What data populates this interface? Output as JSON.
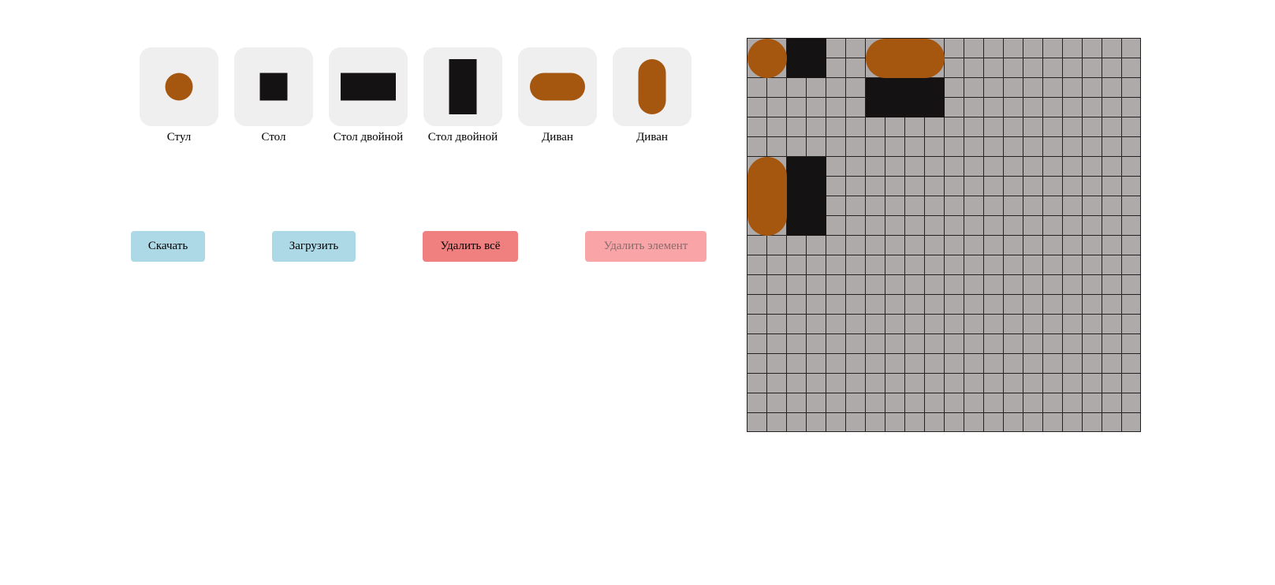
{
  "palette": {
    "items": [
      {
        "label": "Стул",
        "shape": "chair",
        "color": "#a5560f"
      },
      {
        "label": "Стол",
        "shape": "table",
        "color": "#141213"
      },
      {
        "label": "Стол двойной",
        "shape": "table-horizontal",
        "color": "#141213"
      },
      {
        "label": "Стол двойной",
        "shape": "table-vertical",
        "color": "#141213"
      },
      {
        "label": "Диван",
        "shape": "sofa-horizontal",
        "color": "#a5560f"
      },
      {
        "label": "Диван",
        "shape": "sofa-vertical",
        "color": "#a5560f"
      }
    ]
  },
  "buttons": {
    "download": "Скачать",
    "upload": "Загрузить",
    "delete_all": "Удалить всё",
    "delete_element": "Удалить элемент"
  },
  "colors": {
    "wood": "#a5560f",
    "dark": "#141213",
    "tile_bg": "#efefef",
    "grid_bg": "#afaaaa",
    "button_blue": "#add8e6",
    "button_red": "#f08080",
    "button_disabled": "#f9a4a7"
  },
  "floor_grid": {
    "columns": 20,
    "rows": 20,
    "placed_items": [
      {
        "shape": "chair",
        "col": 0,
        "row": 0
      },
      {
        "shape": "table",
        "col": 2,
        "row": 0
      },
      {
        "shape": "sofa-horizontal",
        "col": 6,
        "row": 0
      },
      {
        "shape": "table-horizontal",
        "col": 6,
        "row": 2
      },
      {
        "shape": "sofa-vertical",
        "col": 0,
        "row": 6
      },
      {
        "shape": "table-vertical",
        "col": 2,
        "row": 6
      }
    ]
  }
}
